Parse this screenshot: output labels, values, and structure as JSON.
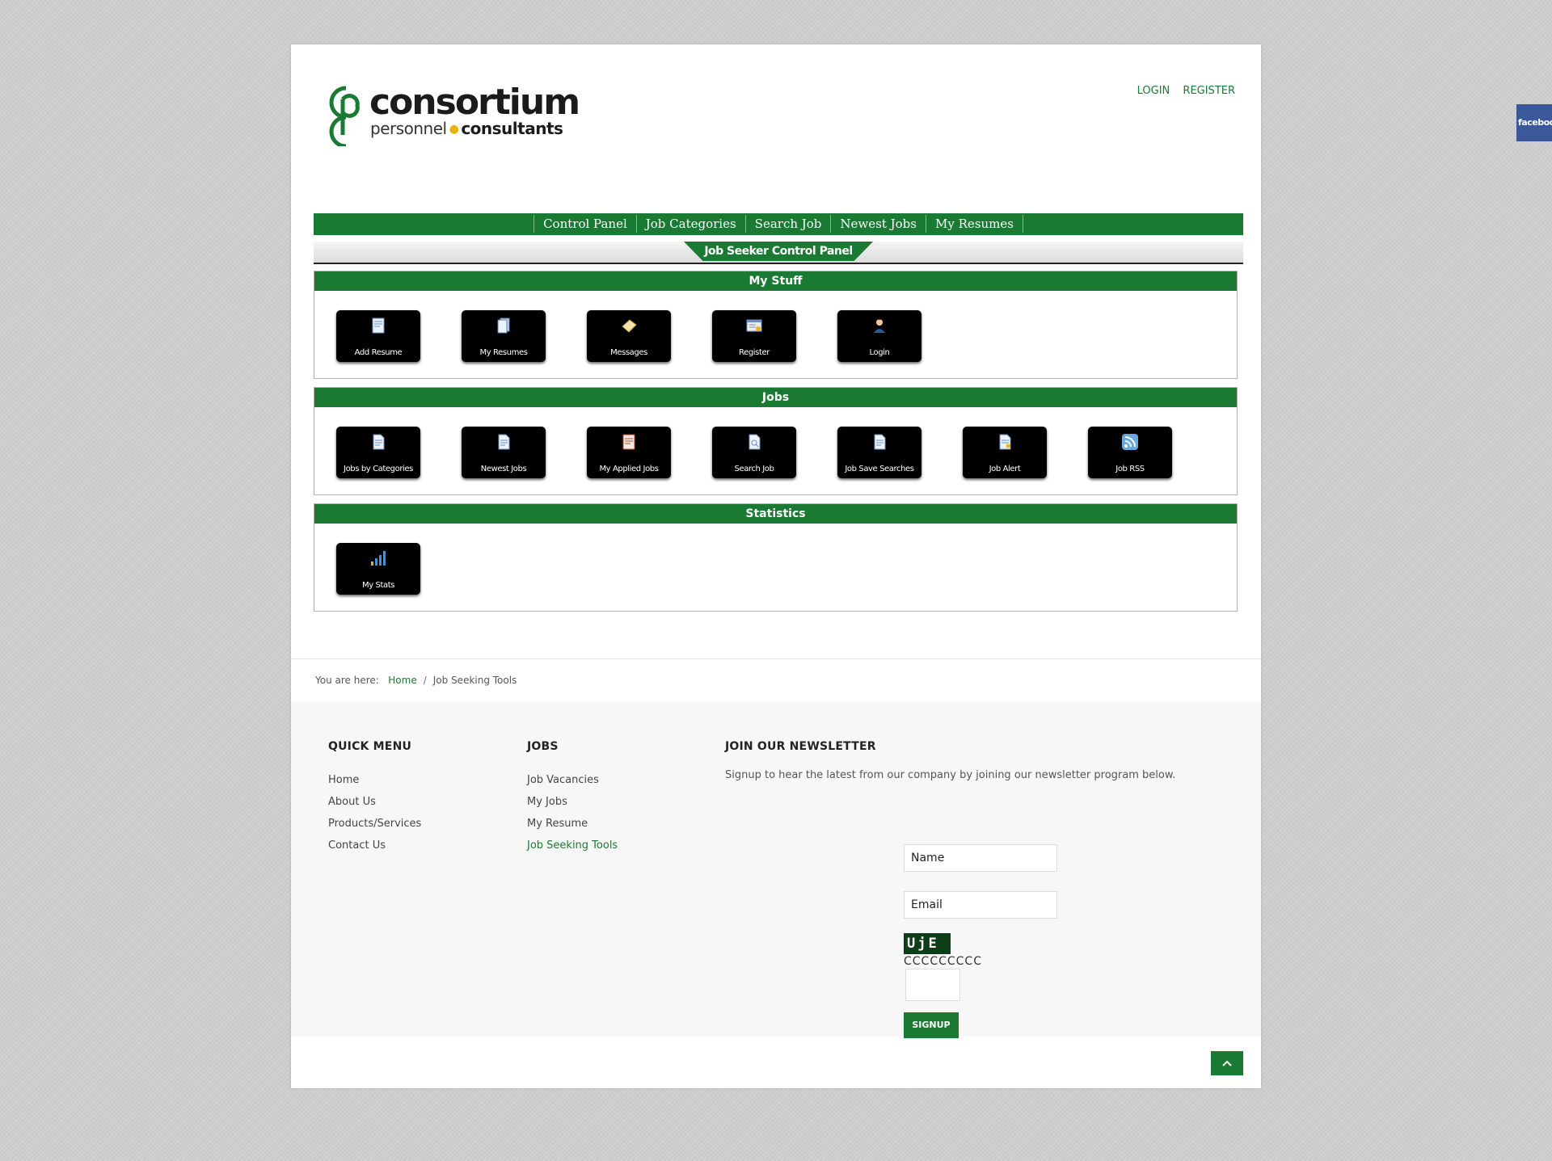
{
  "header": {
    "logo_word": "consortium",
    "logo_sub_1": "personnel",
    "logo_sub_2": "consultants",
    "login": "LOGIN",
    "register": "REGISTER"
  },
  "nav": [
    "Control Panel",
    "Job Categories",
    "Search Job",
    "Newest Jobs",
    "My Resumes"
  ],
  "control_panel_title": "Job Seeker Control Panel",
  "sections": {
    "my_stuff": {
      "title": "My Stuff",
      "tiles": [
        "Add Resume",
        "My Resumes",
        "Messages",
        "Register",
        "Login"
      ]
    },
    "jobs": {
      "title": "Jobs",
      "tiles": [
        "Jobs by Categories",
        "Newest Jobs",
        "My Applied Jobs",
        "Search Job",
        "Job Save Searches",
        "Job Alert",
        "Job RSS"
      ]
    },
    "statistics": {
      "title": "Statistics",
      "tiles": [
        "My Stats"
      ]
    }
  },
  "breadcrumb": {
    "prefix": "You are here:",
    "home": "Home",
    "sep": "/",
    "current": "Job Seeking Tools"
  },
  "footer": {
    "quick_menu": {
      "title": "QUICK MENU",
      "items": [
        "Home",
        "About Us",
        "Products/Services",
        "Contact Us"
      ]
    },
    "jobs": {
      "title": "JOBS",
      "items": [
        "Job Vacancies",
        "My Jobs",
        "My Resume",
        "Job Seeking Tools"
      ]
    },
    "newsletter": {
      "title": "JOIN OUR NEWSLETTER",
      "text": "Signup to hear the latest from our company by joining our newsletter program below.",
      "name_value": "Name",
      "email_value": "Email",
      "captcha_text": "UjE",
      "captcha_row": "CCCCCCCCC",
      "signup": "SIGNUP"
    }
  },
  "facebook_label": "facebook",
  "colors": {
    "brand_green": "#1a7a34",
    "tile_bg": "#000000",
    "facebook": "#3b5998"
  }
}
